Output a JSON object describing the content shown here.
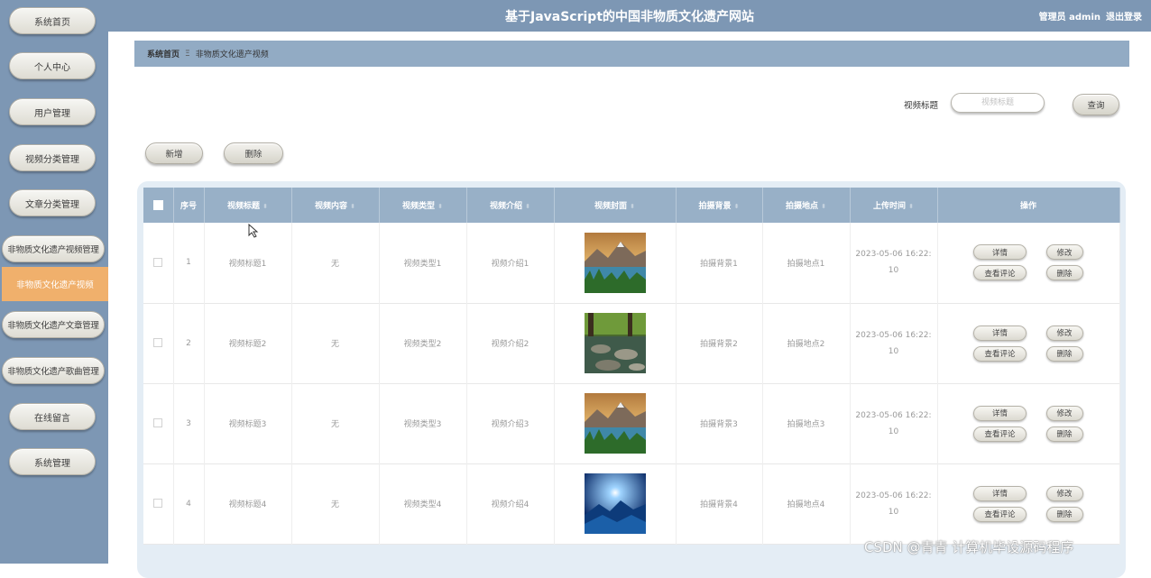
{
  "header": {
    "site_title": "基于JavaScript的中国非物质文化遗产网站",
    "role_label": "管理员 admin",
    "logout_label": "退出登录"
  },
  "sidebar": {
    "items": [
      {
        "label": "系统首页"
      },
      {
        "label": "个人中心"
      },
      {
        "label": "用户管理"
      },
      {
        "label": "视频分类管理"
      },
      {
        "label": "文章分类管理"
      },
      {
        "label": "非物质文化遗产视频管理"
      },
      {
        "label": "非物质文化遗产视频"
      },
      {
        "label": "非物质文化遗产文章管理"
      },
      {
        "label": "非物质文化遗产歌曲管理"
      },
      {
        "label": "在线留言"
      },
      {
        "label": "系统管理"
      }
    ]
  },
  "breadcrumb": {
    "home": "系统首页",
    "separator": "Ξ",
    "current": "非物质文化遗产视频"
  },
  "search": {
    "label": "视频标题",
    "placeholder": "视频标题",
    "button_label": "查询"
  },
  "actions": {
    "add_label": "新增",
    "delete_label": "删除"
  },
  "table": {
    "columns": [
      "序号",
      "视频标题",
      "视频内容",
      "视频类型",
      "视频介绍",
      "视频封面",
      "拍摄背景",
      "拍摄地点",
      "上传时间",
      "操作"
    ],
    "rows": [
      {
        "index": "1",
        "title": "视频标题1",
        "content": "无",
        "type": "视频类型1",
        "intro": "视频介绍1",
        "cover": "mountain-lake",
        "background": "拍摄背景1",
        "location": "拍摄地点1",
        "time_a": "2023-05-06 16:22:",
        "time_b": "10"
      },
      {
        "index": "2",
        "title": "视频标题2",
        "content": "无",
        "type": "视频类型2",
        "intro": "视频介绍2",
        "cover": "forest-stream",
        "background": "拍摄背景2",
        "location": "拍摄地点2",
        "time_a": "2023-05-06 16:22:",
        "time_b": "10"
      },
      {
        "index": "3",
        "title": "视频标题3",
        "content": "无",
        "type": "视频类型3",
        "intro": "视频介绍3",
        "cover": "mountain-lake",
        "background": "拍摄背景3",
        "location": "拍摄地点3",
        "time_a": "2023-05-06 16:22:",
        "time_b": "10"
      },
      {
        "index": "4",
        "title": "视频标题4",
        "content": "无",
        "type": "视频类型4",
        "intro": "视频介绍4",
        "cover": "blue-sun-mountains",
        "background": "拍摄背景4",
        "location": "拍摄地点4",
        "time_a": "2023-05-06 16:22:",
        "time_b": "10"
      }
    ],
    "row_actions": {
      "detail": "详情",
      "edit": "修改",
      "comments": "查看评论",
      "delete": "删除"
    }
  },
  "colors": {
    "sidebar": "#7d97b4",
    "active_item": "#f0b06c",
    "table_header": "#98b0c7"
  },
  "watermark": "CSDN @青青  计算机毕设源码程序"
}
